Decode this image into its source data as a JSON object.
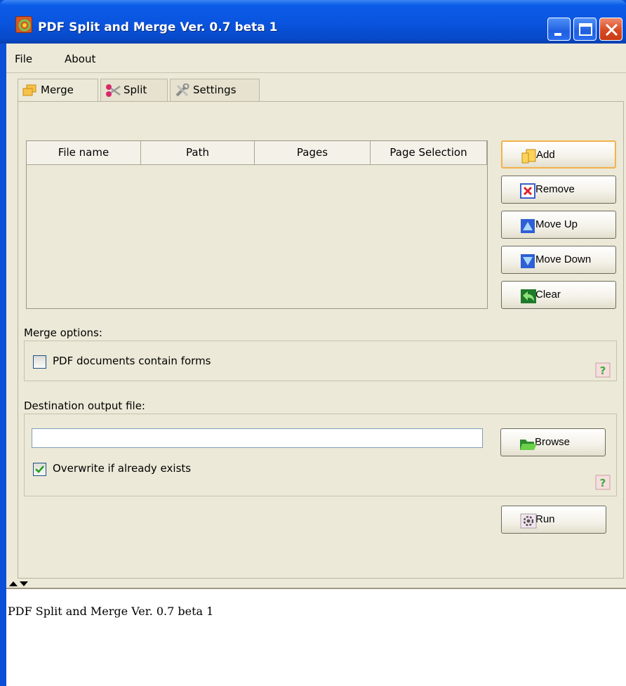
{
  "window": {
    "title": "PDF Split and Merge Ver. 0.7 beta 1",
    "controls": [
      "minimize-icon",
      "maximize-icon",
      "close-icon"
    ]
  },
  "menu": {
    "items": [
      "File",
      "About"
    ]
  },
  "tabs": [
    {
      "label": "Merge",
      "icon": "merge-icon",
      "active": true
    },
    {
      "label": "Split",
      "icon": "scissors-icon",
      "active": false
    },
    {
      "label": "Settings",
      "icon": "tools-icon",
      "active": false
    }
  ],
  "merge": {
    "table": {
      "columns": [
        "File name",
        "Path",
        "Pages",
        "Page Selection"
      ],
      "rows": []
    },
    "buttons": {
      "add": "Add",
      "remove": "Remove",
      "move_up": "Move Up",
      "move_down": "Move Down",
      "clear": "Clear",
      "browse": "Browse",
      "run": "Run"
    },
    "options_label": "Merge options:",
    "forms_checkbox": {
      "label": "PDF documents contain forms",
      "checked": false
    },
    "destination_label": "Destination output file:",
    "destination_value": "",
    "overwrite_checkbox": {
      "label": "Overwrite if already exists",
      "checked": true
    }
  },
  "log": {
    "lines": [
      "PDF Split and Merge Ver. 0.7 beta 1"
    ]
  },
  "colors": {
    "titlebar": "#0a55e0",
    "panel": "#ece9d8",
    "focus": "#f2b24b",
    "check": "#21a121"
  }
}
